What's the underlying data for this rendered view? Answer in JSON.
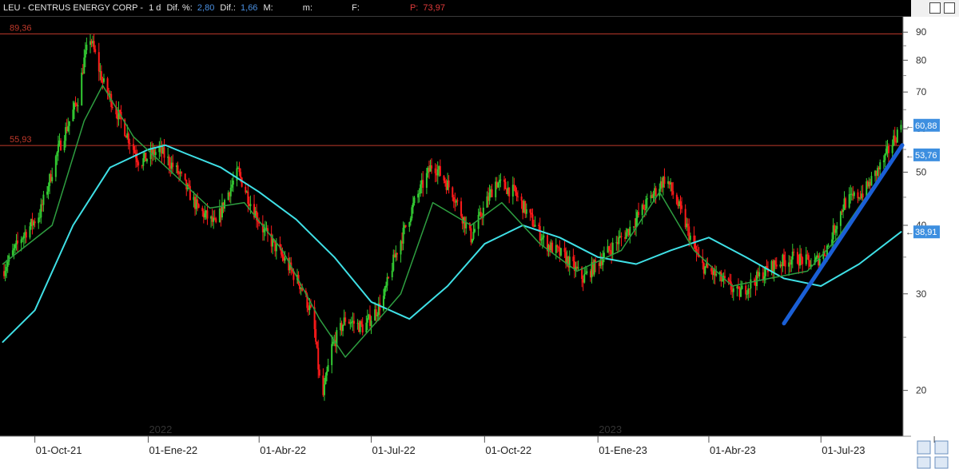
{
  "header": {
    "symbol": "LEU - CENTRUS ENERGY CORP -",
    "timeframe": "1 d",
    "dif_pct_label": "Dif. %:",
    "dif_pct_value": "2,80",
    "dif_label": "Dif.:",
    "dif_value": "1,66",
    "m_label": "M:",
    "m2_label": "m:",
    "f_label": "F:",
    "p_label": "P:",
    "p_value": "73,97"
  },
  "chart_data": {
    "type": "candlestick",
    "y_scale": "log",
    "ylim": [
      16.5,
      96
    ],
    "y_ticks": [
      20,
      30,
      40,
      50,
      60,
      70,
      80,
      90
    ],
    "x_range": [
      "2021-09-04",
      "2023-09-05"
    ],
    "x_ticks": [
      {
        "date": "2021-10-01",
        "label": "01-Oct-21"
      },
      {
        "date": "2022-01-01",
        "label": "01-Ene-22"
      },
      {
        "date": "2022-04-01",
        "label": "01-Abr-22"
      },
      {
        "date": "2022-07-01",
        "label": "01-Jul-22"
      },
      {
        "date": "2022-10-01",
        "label": "01-Oct-22"
      },
      {
        "date": "2023-01-01",
        "label": "01-Ene-23"
      },
      {
        "date": "2023-04-01",
        "label": "01-Abr-23"
      },
      {
        "date": "2023-07-01",
        "label": "01-Jul-23"
      },
      {
        "date": "2023-10-01",
        "label": "01"
      }
    ],
    "year_labels": [
      {
        "date": "2022-01-01",
        "label": "2022"
      },
      {
        "date": "2023-01-01",
        "label": "2023"
      }
    ],
    "price_path": [
      [
        "2021-09-05",
        33
      ],
      [
        "2021-09-20",
        38
      ],
      [
        "2021-10-05",
        42
      ],
      [
        "2021-10-20",
        55
      ],
      [
        "2021-11-05",
        68
      ],
      [
        "2021-11-10",
        80
      ],
      [
        "2021-11-15",
        88
      ],
      [
        "2021-11-25",
        73
      ],
      [
        "2021-12-10",
        62
      ],
      [
        "2021-12-25",
        52
      ],
      [
        "2022-01-10",
        55
      ],
      [
        "2022-01-25",
        50
      ],
      [
        "2022-02-10",
        43
      ],
      [
        "2022-02-25",
        40
      ],
      [
        "2022-03-05",
        45
      ],
      [
        "2022-03-15",
        50
      ],
      [
        "2022-03-25",
        44
      ],
      [
        "2022-04-05",
        39
      ],
      [
        "2022-04-20",
        35
      ],
      [
        "2022-05-05",
        31
      ],
      [
        "2022-05-15",
        27
      ],
      [
        "2022-05-22",
        19
      ],
      [
        "2022-05-30",
        24
      ],
      [
        "2022-06-10",
        27
      ],
      [
        "2022-06-25",
        26
      ],
      [
        "2022-07-10",
        29
      ],
      [
        "2022-07-20",
        35
      ],
      [
        "2022-08-05",
        44
      ],
      [
        "2022-08-20",
        52
      ],
      [
        "2022-09-05",
        46
      ],
      [
        "2022-09-20",
        38
      ],
      [
        "2022-10-10",
        48
      ],
      [
        "2022-10-25",
        46
      ],
      [
        "2022-11-05",
        42
      ],
      [
        "2022-11-20",
        37
      ],
      [
        "2022-12-05",
        35
      ],
      [
        "2022-12-20",
        32
      ],
      [
        "2023-01-10",
        36
      ],
      [
        "2023-01-25",
        39
      ],
      [
        "2023-02-10",
        44
      ],
      [
        "2023-02-25",
        49
      ],
      [
        "2023-03-10",
        42
      ],
      [
        "2023-03-25",
        34
      ],
      [
        "2023-04-10",
        32
      ],
      [
        "2023-04-25",
        30
      ],
      [
        "2023-05-10",
        32
      ],
      [
        "2023-05-25",
        34
      ],
      [
        "2023-06-10",
        35
      ],
      [
        "2023-06-25",
        34
      ],
      [
        "2023-07-05",
        36
      ],
      [
        "2023-07-20",
        44
      ],
      [
        "2023-08-05",
        46
      ],
      [
        "2023-08-20",
        52
      ],
      [
        "2023-09-04",
        60.88
      ]
    ],
    "ma_fast": [
      [
        "2021-09-05",
        34
      ],
      [
        "2021-10-15",
        40
      ],
      [
        "2021-11-10",
        62
      ],
      [
        "2021-11-25",
        72
      ],
      [
        "2021-12-20",
        58
      ],
      [
        "2022-01-20",
        50
      ],
      [
        "2022-02-20",
        43
      ],
      [
        "2022-03-20",
        44
      ],
      [
        "2022-04-20",
        36
      ],
      [
        "2022-05-20",
        27
      ],
      [
        "2022-06-10",
        23
      ],
      [
        "2022-07-01",
        26
      ],
      [
        "2022-07-25",
        30
      ],
      [
        "2022-08-20",
        44
      ],
      [
        "2022-09-20",
        40
      ],
      [
        "2022-10-15",
        44
      ],
      [
        "2022-11-15",
        37
      ],
      [
        "2022-12-15",
        33
      ],
      [
        "2023-01-20",
        36
      ],
      [
        "2023-02-20",
        46
      ],
      [
        "2023-03-20",
        36
      ],
      [
        "2023-04-20",
        31
      ],
      [
        "2023-05-20",
        32
      ],
      [
        "2023-06-20",
        33
      ],
      [
        "2023-07-15",
        38
      ],
      [
        "2023-08-15",
        48
      ],
      [
        "2023-09-04",
        55
      ]
    ],
    "ma_slow": [
      [
        "2021-09-05",
        24.5
      ],
      [
        "2021-10-01",
        28
      ],
      [
        "2021-11-01",
        40
      ],
      [
        "2021-12-01",
        51
      ],
      [
        "2022-01-01",
        55
      ],
      [
        "2022-01-15",
        56
      ],
      [
        "2022-02-01",
        54
      ],
      [
        "2022-03-01",
        51
      ],
      [
        "2022-04-01",
        46
      ],
      [
        "2022-05-01",
        41
      ],
      [
        "2022-06-01",
        35
      ],
      [
        "2022-07-01",
        29
      ],
      [
        "2022-08-01",
        27
      ],
      [
        "2022-09-01",
        31
      ],
      [
        "2022-10-01",
        37
      ],
      [
        "2022-11-01",
        40
      ],
      [
        "2022-12-01",
        38
      ],
      [
        "2023-01-01",
        35
      ],
      [
        "2023-02-01",
        34
      ],
      [
        "2023-03-01",
        36
      ],
      [
        "2023-04-01",
        38
      ],
      [
        "2023-05-01",
        35
      ],
      [
        "2023-06-01",
        32
      ],
      [
        "2023-07-01",
        31
      ],
      [
        "2023-08-01",
        34
      ],
      [
        "2023-09-04",
        38.91
      ]
    ],
    "horizontal_lines": [
      {
        "value": 89.36,
        "label": "89,36"
      },
      {
        "value": 55.93,
        "label": "55,93"
      }
    ],
    "trendline": {
      "from": [
        "2023-06-01",
        26.5
      ],
      "to": [
        "2023-09-05",
        56
      ]
    },
    "price_tags": [
      {
        "value": 60.88,
        "label": "60,88"
      },
      {
        "value": 53.76,
        "label": "53,76"
      },
      {
        "value": 38.91,
        "label": "38,91"
      }
    ]
  },
  "colors": {
    "up": "#33cc33",
    "down": "#ff1a1a",
    "ma_fast": "#2e9e40",
    "ma_slow": "#3fe0e6",
    "trendline": "#1a5fd6",
    "hline": "#c0392b",
    "tag_bg": "#3d8fe0",
    "background": "#000000"
  }
}
